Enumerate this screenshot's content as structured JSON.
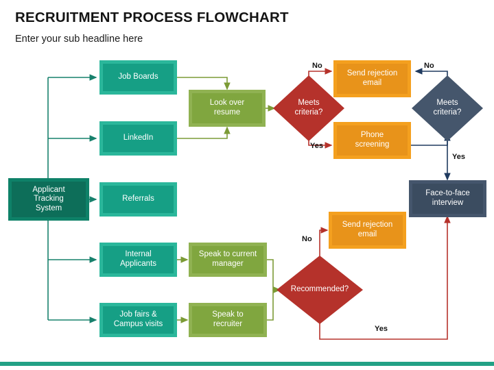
{
  "header": {
    "title": "RECRUITMENT PROCESS FLOWCHART",
    "subtitle": "Enter your sub headline here"
  },
  "colors": {
    "teal": "#2bb79b",
    "teal_inner": "#169f85",
    "teal_dark": "#0e8168",
    "teal_dark_inner": "#0d6e59",
    "green": "#90b252",
    "green_inner": "#80a63f",
    "orange": "#f4a01f",
    "orange_inner": "#e8931a",
    "slate": "#45566c",
    "slate_inner": "#3b4c60",
    "red": "#b5322b",
    "footer_bar": "#22a185",
    "connector_teal": "#17806c",
    "connector_green": "#7c9b36",
    "connector_red": "#b5322b",
    "connector_slate": "#1f3a5f"
  },
  "nodes": {
    "applicant_tracking_system": "Applicant\nTracking\nSystem",
    "job_boards": "Job Boards",
    "linkedin": "LinkedIn",
    "referrals": "Referrals",
    "internal_applicants": "Internal\nApplicants",
    "job_fairs": "Job fairs &\nCampus visits",
    "look_over_resume": "Look over\nresume",
    "speak_to_current_manager": "Speak to current\nmanager",
    "speak_to_recruiter": "Speak to\nrecruiter",
    "send_rejection_email_top": "Send rejection\nemail",
    "send_rejection_email_bottom": "Send rejection\nemail",
    "phone_screening": "Phone\nscreening",
    "face_to_face_interview": "Face-to-face\ninterview"
  },
  "decisions": {
    "meets_criteria_resume": "Meets\ncriteria?",
    "meets_criteria_phone": "Meets\ncriteria?",
    "recommended": "Recommended?"
  },
  "edge_labels": {
    "resume_no": "No",
    "resume_yes": "Yes",
    "phone_no": "No",
    "phone_yes": "Yes",
    "recommended_no": "No",
    "recommended_yes": "Yes"
  }
}
